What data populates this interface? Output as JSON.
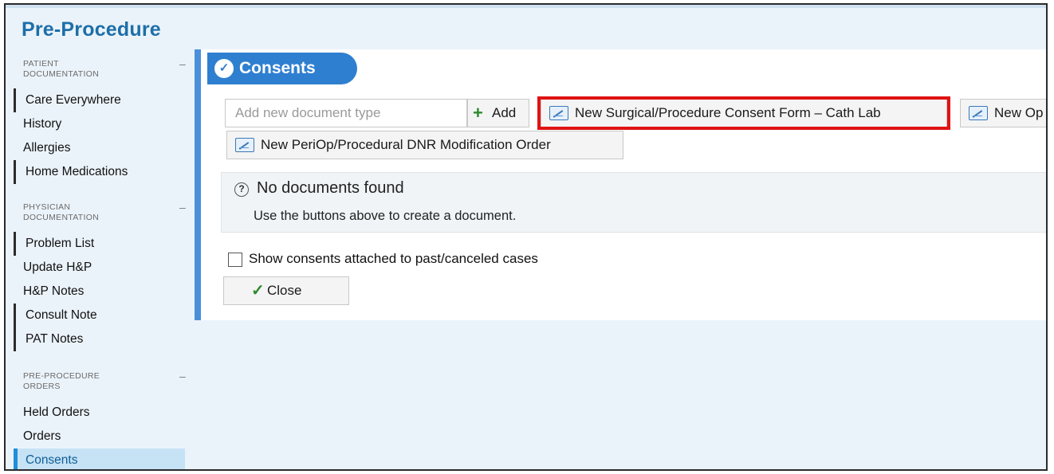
{
  "app": {
    "title": "Pre-Procedure"
  },
  "sidebar": {
    "sections": [
      {
        "heading_line1": "Patient",
        "heading_line2": "Documentation",
        "toggle": "–",
        "items": [
          "Care Everywhere",
          "History",
          "Allergies",
          "Home Medications"
        ]
      },
      {
        "heading_line1": "Physician",
        "heading_line2": "Documentation",
        "toggle": "–",
        "items": [
          "Problem List",
          "Update H&P",
          "H&P Notes",
          "Consult Note",
          "PAT Notes"
        ]
      },
      {
        "heading_line1": "Pre-Procedure",
        "heading_line2": "Orders",
        "toggle": "–",
        "items": [
          "Held Orders",
          "Orders",
          "Consents"
        ]
      }
    ],
    "active_item": "Consents"
  },
  "panel": {
    "title": "Consents",
    "add_input_placeholder": "Add new document type",
    "add_button": "Add",
    "doc_buttons": [
      "New Surgical/Procedure Consent Form – Cath Lab",
      "New Op",
      "New PeriOp/Procedural DNR Modification Order"
    ],
    "empty_state": {
      "title": "No documents found",
      "message": "Use the buttons above to create a document."
    },
    "show_past_checkbox": {
      "label": "Show consents attached to past/canceled cases",
      "checked": false
    },
    "close_button": "Close"
  },
  "colors": {
    "accent": "#2f7fd0",
    "highlight": "#e01313",
    "active_nav": "#c6e2f5"
  }
}
